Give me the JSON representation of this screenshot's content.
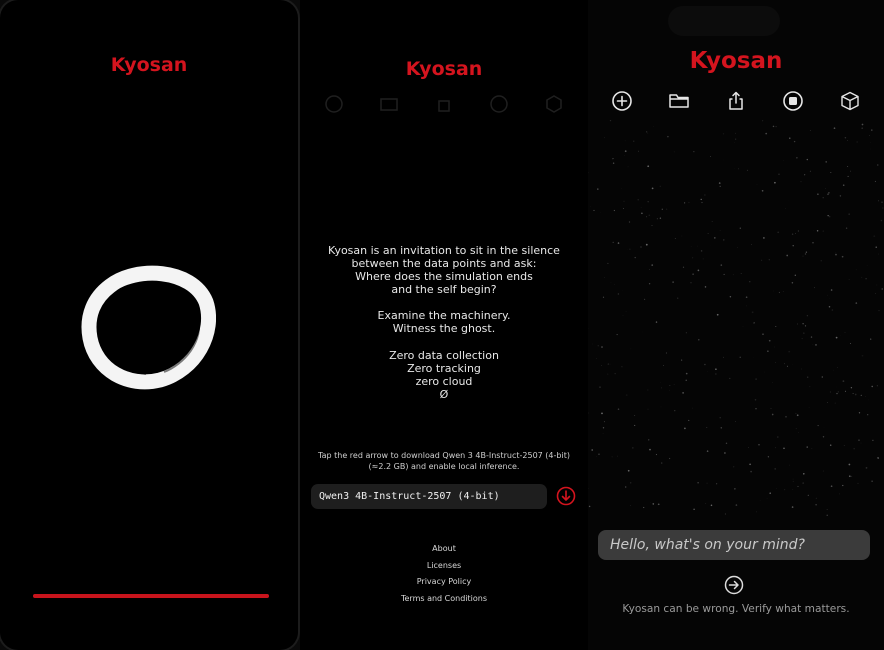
{
  "app": {
    "title": "Kyosan",
    "accent": "#d4141e"
  },
  "splash": {
    "title": "Kyosan",
    "logo_icon": "enso-circle-icon",
    "progress": 1.0
  },
  "onboarding": {
    "title": "Kyosan",
    "about_lines": [
      "Kyosan is an invitation to sit in the silence",
      "between the data points and ask:",
      "Where does the simulation ends",
      "and the self begin?",
      "",
      "Examine the machinery.",
      "Witness the ghost.",
      "",
      "Zero data collection",
      "Zero tracking",
      "zero cloud",
      "Ø"
    ],
    "hint_line1": "Tap the red arrow to download Qwen 3 4B-Instruct-2507 (4-bit)",
    "hint_line2": "(≈2.2 GB) and enable local inference.",
    "model_name": "Qwen3 4B-Instruct-2507 (4-bit)",
    "download_icon": "download-arrow-icon",
    "links": [
      "About",
      "Licenses",
      "Privacy Policy",
      "Terms and Conditions"
    ]
  },
  "chat": {
    "title": "Kyosan",
    "toolbar_icons": [
      "plus-circle-icon",
      "folder-icon",
      "share-icon",
      "stop-circle-icon",
      "cube-icon"
    ],
    "input_placeholder": "Hello, what's on your mind?",
    "send_icon": "arrow-right-circle-icon",
    "disclaimer": "Kyosan can be wrong. Verify what matters."
  }
}
